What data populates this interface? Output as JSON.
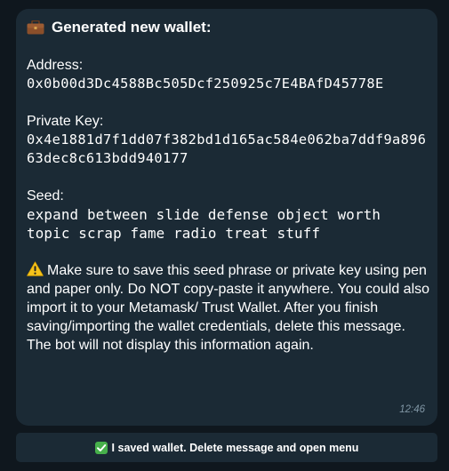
{
  "message": {
    "title": "Generated new wallet:",
    "address_label": "Address:",
    "address_value": "0x0b00d3Dc4588Bc505Dcf250925c7E4BAfD45778E",
    "private_key_label": "Private Key:",
    "private_key_value": "0x4e1881d7f1dd07f382bd1d165ac584e062ba7ddf9a89663dec8c613bdd940177",
    "seed_label": "Seed:",
    "seed_value": "expand between slide defense object worth topic scrap fame radio treat stuff",
    "warning_text": "Make sure to save this seed phrase or private key using pen and paper only. Do NOT copy-paste it anywhere. You could also import it to your Metamask/ Trust Wallet. After you finish saving/importing the wallet credentials, delete this message. The bot will not display this information again.",
    "time": "12:46",
    "title_icon": "briefcase-icon",
    "warning_icon": "warning-icon"
  },
  "keyboard": {
    "button_label": "I saved wallet. Delete message and open menu",
    "button_icon": "check-icon"
  },
  "colors": {
    "background": "#0f171e",
    "bubble": "#1b2a35",
    "text": "#ffffff",
    "timestamp": "#7f95a3",
    "check_green": "#47b04b",
    "warning_yellow": "#f5c21b"
  }
}
